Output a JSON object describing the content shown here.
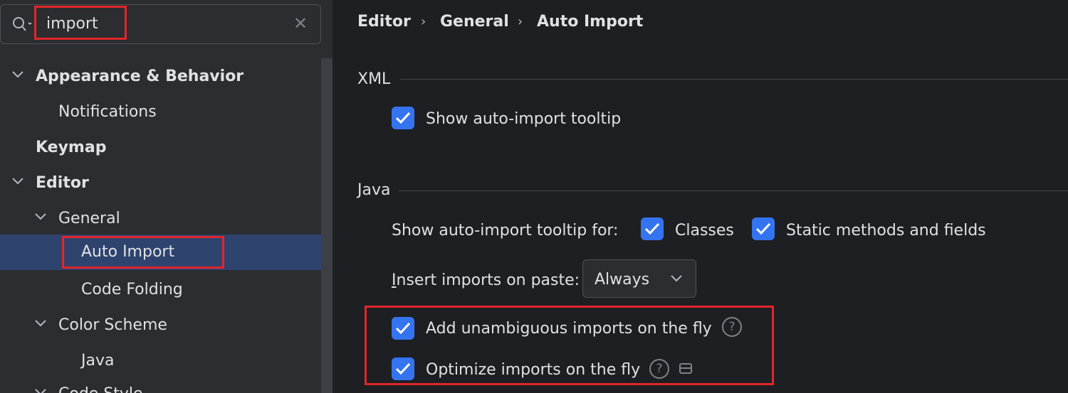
{
  "search": {
    "query": "import"
  },
  "tree": {
    "appearance": "Appearance & Behavior",
    "notifications": "Notifications",
    "keymap": "Keymap",
    "editor": "Editor",
    "general": "General",
    "auto_import": "Auto Import",
    "code_folding": "Code Folding",
    "color_scheme": "Color Scheme",
    "java": "Java",
    "code_style": "Code Style"
  },
  "breadcrumb": {
    "editor": "Editor",
    "general": "General",
    "auto_import": "Auto Import",
    "separator": "›"
  },
  "xml_section": {
    "title": "XML",
    "show_tooltip": "Show auto-import tooltip"
  },
  "java_section": {
    "title": "Java",
    "tooltip_for_label": "Show auto-import tooltip for:",
    "classes": "Classes",
    "static_methods": "Static methods and fields",
    "insert_label_first": "I",
    "insert_label_rest": "nsert imports on paste:",
    "insert_value": "Always",
    "add_unambiguous": "Add unambiguous imports on the fly",
    "optimize": "Optimize imports on the fly"
  },
  "help_glyph": "?",
  "clear_glyph": "✕",
  "colors": {
    "accent": "#3574f0",
    "selection": "#2e436e",
    "highlight_box": "#e2262a"
  }
}
